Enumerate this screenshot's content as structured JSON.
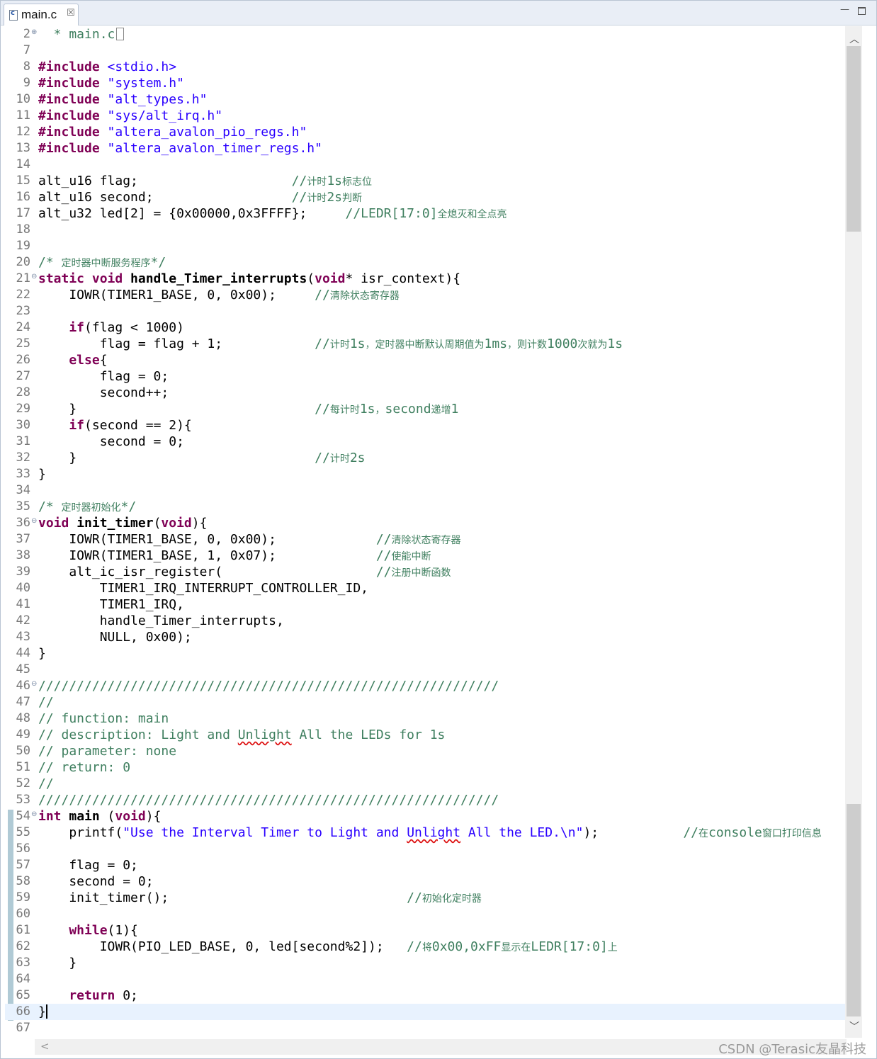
{
  "tab": {
    "label": "main.c",
    "close": "☒"
  },
  "window": {
    "minimize": "—"
  },
  "watermark": "CSDN @Terasic友晶科技",
  "lines": [
    {
      "n": "2",
      "fold": "⊕",
      "tokens": [
        [
          "cm",
          "  * main.c"
        ]
      ],
      "mark": true
    },
    {
      "n": "7",
      "tokens": []
    },
    {
      "n": "8",
      "tokens": [
        [
          "kw",
          "#include "
        ],
        [
          "str",
          "<stdio.h>"
        ]
      ]
    },
    {
      "n": "9",
      "tokens": [
        [
          "kw",
          "#include "
        ],
        [
          "str",
          "\"system.h\""
        ]
      ]
    },
    {
      "n": "10",
      "tokens": [
        [
          "kw",
          "#include "
        ],
        [
          "str",
          "\"alt_types.h\""
        ]
      ]
    },
    {
      "n": "11",
      "tokens": [
        [
          "kw",
          "#include "
        ],
        [
          "str",
          "\"sys/alt_irq.h\""
        ]
      ]
    },
    {
      "n": "12",
      "tokens": [
        [
          "kw",
          "#include "
        ],
        [
          "str",
          "\"altera_avalon_pio_regs.h\""
        ]
      ]
    },
    {
      "n": "13",
      "tokens": [
        [
          "kw",
          "#include "
        ],
        [
          "str",
          "\"altera_avalon_timer_regs.h\""
        ]
      ]
    },
    {
      "n": "14",
      "tokens": []
    },
    {
      "n": "15",
      "tokens": [
        [
          "",
          "alt_u16 flag;                    "
        ],
        [
          "cm",
          "//"
        ],
        [
          "cn",
          "计时"
        ],
        [
          "cm",
          "1s"
        ],
        [
          "cn",
          "标志位"
        ]
      ]
    },
    {
      "n": "16",
      "tokens": [
        [
          "",
          "alt_u16 second;                  "
        ],
        [
          "cm",
          "//"
        ],
        [
          "cn",
          "计时"
        ],
        [
          "cm",
          "2s"
        ],
        [
          "cn",
          "判断"
        ]
      ]
    },
    {
      "n": "17",
      "tokens": [
        [
          "",
          "alt_u32 led[2] = {0x00000,0x3FFFF};     "
        ],
        [
          "cm",
          "//LEDR[17:0]"
        ],
        [
          "cn",
          "全熄灭和全点亮"
        ]
      ]
    },
    {
      "n": "18",
      "tokens": []
    },
    {
      "n": "19",
      "tokens": []
    },
    {
      "n": "20",
      "tokens": [
        [
          "cm",
          "/* "
        ],
        [
          "cn",
          "定时器中断服务程序"
        ],
        [
          "cm",
          "*/"
        ]
      ]
    },
    {
      "n": "21",
      "fold": "⊖",
      "tokens": [
        [
          "kw",
          "static void "
        ],
        [
          "",
          "handle_Timer_interrupts"
        ],
        [
          "",
          "("
        ],
        [
          "kw",
          "void"
        ],
        [
          "",
          "* isr_context){"
        ]
      ],
      "boldname": true
    },
    {
      "n": "22",
      "tokens": [
        [
          "",
          "    IOWR(TIMER1_BASE, 0, 0x00);     "
        ],
        [
          "cm",
          "//"
        ],
        [
          "cn",
          "清除状态寄存器"
        ]
      ]
    },
    {
      "n": "23",
      "tokens": []
    },
    {
      "n": "24",
      "tokens": [
        [
          "kw",
          "    if"
        ],
        [
          "",
          "(flag < 1000)"
        ]
      ]
    },
    {
      "n": "25",
      "tokens": [
        [
          "",
          "        flag = flag + 1;            "
        ],
        [
          "cm",
          "//"
        ],
        [
          "cn",
          "计时"
        ],
        [
          "cm",
          "1s"
        ],
        [
          "cn",
          "，定时器中断默认周期值为"
        ],
        [
          "cm",
          "1ms"
        ],
        [
          "cn",
          "，则计数"
        ],
        [
          "cm",
          "1000"
        ],
        [
          "cn",
          "次就为"
        ],
        [
          "cm",
          "1s"
        ]
      ]
    },
    {
      "n": "26",
      "tokens": [
        [
          "kw",
          "    else"
        ],
        [
          "",
          "{"
        ]
      ]
    },
    {
      "n": "27",
      "tokens": [
        [
          "",
          "        flag = 0;"
        ]
      ]
    },
    {
      "n": "28",
      "tokens": [
        [
          "",
          "        second++;"
        ]
      ]
    },
    {
      "n": "29",
      "tokens": [
        [
          "",
          "    }                               "
        ],
        [
          "cm",
          "//"
        ],
        [
          "cn",
          "每计时"
        ],
        [
          "cm",
          "1s"
        ],
        [
          "cn",
          "，"
        ],
        [
          "cm",
          "second"
        ],
        [
          "cn",
          "递增"
        ],
        [
          "cm",
          "1"
        ]
      ]
    },
    {
      "n": "30",
      "tokens": [
        [
          "kw",
          "    if"
        ],
        [
          "",
          "(second == 2){"
        ]
      ]
    },
    {
      "n": "31",
      "tokens": [
        [
          "",
          "        second = 0;"
        ]
      ]
    },
    {
      "n": "32",
      "tokens": [
        [
          "",
          "    }                               "
        ],
        [
          "cm",
          "//"
        ],
        [
          "cn",
          "计时"
        ],
        [
          "cm",
          "2s"
        ]
      ]
    },
    {
      "n": "33",
      "tokens": [
        [
          "",
          "}"
        ]
      ]
    },
    {
      "n": "34",
      "tokens": []
    },
    {
      "n": "35",
      "tokens": [
        [
          "cm",
          "/* "
        ],
        [
          "cn",
          "定时器初始化"
        ],
        [
          "cm",
          "*/"
        ]
      ]
    },
    {
      "n": "36",
      "fold": "⊖",
      "tokens": [
        [
          "kw",
          "void "
        ],
        [
          "b",
          "init_timer"
        ],
        [
          "",
          "("
        ],
        [
          "kw",
          "void"
        ],
        [
          "",
          "){"
        ]
      ]
    },
    {
      "n": "37",
      "tokens": [
        [
          "",
          "    IOWR(TIMER1_BASE, 0, 0x00);             "
        ],
        [
          "cm",
          "//"
        ],
        [
          "cn",
          "清除状态寄存器"
        ]
      ]
    },
    {
      "n": "38",
      "tokens": [
        [
          "",
          "    IOWR(TIMER1_BASE, 1, 0x07);             "
        ],
        [
          "cm",
          "//"
        ],
        [
          "cn",
          "使能中断"
        ]
      ]
    },
    {
      "n": "39",
      "tokens": [
        [
          "",
          "    alt_ic_isr_register(                    "
        ],
        [
          "cm",
          "//"
        ],
        [
          "cn",
          "注册中断函数"
        ]
      ]
    },
    {
      "n": "40",
      "tokens": [
        [
          "",
          "        TIMER1_IRQ_INTERRUPT_CONTROLLER_ID,"
        ]
      ]
    },
    {
      "n": "41",
      "tokens": [
        [
          "",
          "        TIMER1_IRQ,"
        ]
      ]
    },
    {
      "n": "42",
      "tokens": [
        [
          "",
          "        handle_Timer_interrupts,"
        ]
      ]
    },
    {
      "n": "43",
      "tokens": [
        [
          "",
          "        NULL, 0x00);"
        ]
      ]
    },
    {
      "n": "44",
      "tokens": [
        [
          "",
          "}"
        ]
      ]
    },
    {
      "n": "45",
      "tokens": []
    },
    {
      "n": "46",
      "fold": "⊖",
      "tokens": [
        [
          "cm",
          "////////////////////////////////////////////////////////////"
        ]
      ]
    },
    {
      "n": "47",
      "tokens": [
        [
          "cm",
          "//"
        ]
      ]
    },
    {
      "n": "48",
      "tokens": [
        [
          "cm",
          "// function: main"
        ]
      ]
    },
    {
      "n": "49",
      "tokens": [
        [
          "cm",
          "// description: Light and "
        ],
        [
          "cmsq",
          "Unlight"
        ],
        [
          "cm",
          " All the LEDs for 1s"
        ]
      ]
    },
    {
      "n": "50",
      "tokens": [
        [
          "cm",
          "// parameter: none"
        ]
      ]
    },
    {
      "n": "51",
      "tokens": [
        [
          "cm",
          "// return: 0"
        ]
      ]
    },
    {
      "n": "52",
      "tokens": [
        [
          "cm",
          "//"
        ]
      ]
    },
    {
      "n": "53",
      "tokens": [
        [
          "cm",
          "////////////////////////////////////////////////////////////"
        ]
      ]
    },
    {
      "n": "54",
      "fold": "⊖",
      "tokens": [
        [
          "kw",
          "int "
        ],
        [
          "b",
          "main"
        ],
        [
          "",
          " ("
        ],
        [
          "kw",
          "void"
        ],
        [
          "",
          "){"
        ]
      ]
    },
    {
      "n": "55",
      "tokens": [
        [
          "",
          "    printf("
        ],
        [
          "str",
          "\"Use the Interval Timer to Light and "
        ],
        [
          "strsq",
          "Unlight"
        ],
        [
          "str",
          " All the LED.\\n\""
        ],
        [
          "",
          ");           "
        ],
        [
          "cm",
          "//"
        ],
        [
          "cn",
          "在"
        ],
        [
          "cm",
          "console"
        ],
        [
          "cn",
          "窗口打印信息"
        ]
      ]
    },
    {
      "n": "56",
      "tokens": []
    },
    {
      "n": "57",
      "tokens": [
        [
          "",
          "    flag = 0;"
        ]
      ]
    },
    {
      "n": "58",
      "tokens": [
        [
          "",
          "    second = 0;"
        ]
      ]
    },
    {
      "n": "59",
      "tokens": [
        [
          "",
          "    init_timer();                               "
        ],
        [
          "cm",
          "//"
        ],
        [
          "cn",
          "初始化定时器"
        ]
      ]
    },
    {
      "n": "60",
      "tokens": []
    },
    {
      "n": "61",
      "tokens": [
        [
          "kw",
          "    while"
        ],
        [
          "",
          "(1){"
        ]
      ]
    },
    {
      "n": "62",
      "tokens": [
        [
          "",
          "        IOWR(PIO_LED_BASE, 0, led[second%2]);   "
        ],
        [
          "cm",
          "//"
        ],
        [
          "cn",
          "将"
        ],
        [
          "cm",
          "0x00,0xFF"
        ],
        [
          "cn",
          "显示在"
        ],
        [
          "cm",
          "LEDR[17:0]"
        ],
        [
          "cn",
          "上"
        ]
      ]
    },
    {
      "n": "63",
      "tokens": [
        [
          "",
          "    }"
        ]
      ]
    },
    {
      "n": "64",
      "tokens": []
    },
    {
      "n": "65",
      "tokens": [
        [
          "kw",
          "    return "
        ],
        [
          "",
          "0;"
        ]
      ]
    },
    {
      "n": "66",
      "tokens": [
        [
          "",
          "}"
        ]
      ],
      "current": true,
      "caret": true
    },
    {
      "n": "67",
      "tokens": []
    }
  ]
}
